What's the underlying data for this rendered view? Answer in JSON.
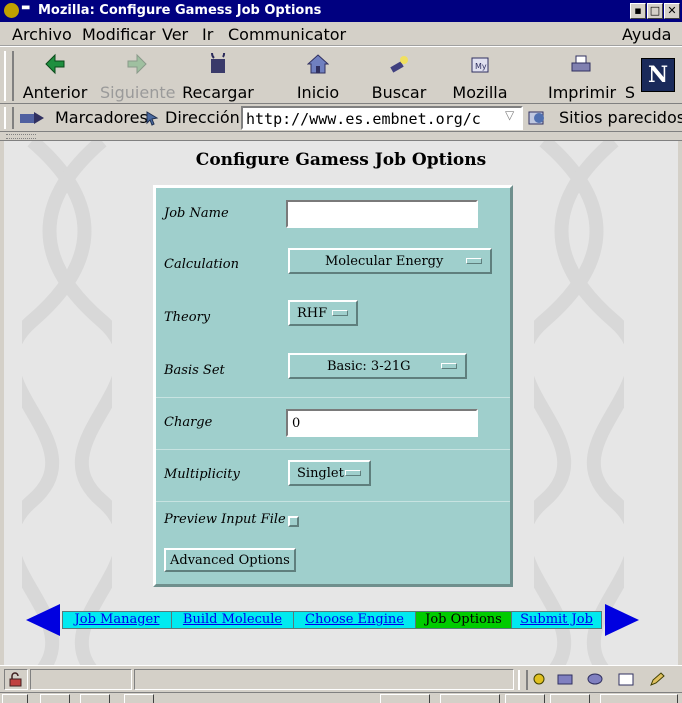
{
  "window": {
    "title": "Mozilla: Configure Gamess Job Options"
  },
  "menubar": {
    "items": [
      "Archivo",
      "Modificar",
      "Ver",
      "Ir",
      "Communicator"
    ],
    "help": "Ayuda"
  },
  "toolbar": {
    "back": "Anterior",
    "forward": "Siguiente",
    "reload": "Recargar",
    "home": "Inicio",
    "search": "Buscar",
    "mozilla": "Mozilla",
    "print": "Imprimir",
    "security": "S",
    "logo_letter": "N"
  },
  "locationbar": {
    "bookmarks": "Marcadores",
    "address_label": "Dirección:",
    "url": "http://www.es.embnet.org/c",
    "related": "Sitios parecidos"
  },
  "page": {
    "title": "Configure Gamess Job Options",
    "form": {
      "job_name_label": "Job Name",
      "job_name_value": "",
      "calculation_label": "Calculation",
      "calculation_value": "Molecular Energy",
      "theory_label": "Theory",
      "theory_value": "RHF",
      "basis_label": "Basis Set",
      "basis_value": "Basic: 3-21G",
      "charge_label": "Charge",
      "charge_value": "0",
      "multiplicity_label": "Multiplicity",
      "multiplicity_value": "Singlet",
      "preview_label": "Preview Input File",
      "preview_checked": false,
      "advanced_button": "Advanced Options"
    },
    "nav": {
      "items": [
        "Job Manager",
        "Build Molecule",
        "Choose Engine",
        "Job Options",
        "Submit Job"
      ],
      "active": "Job Options"
    }
  },
  "colors": {
    "panel": "#9fcfcc",
    "nav_strip": "#00eaf0",
    "nav_active": "#00cc00",
    "nav_arrow": "#0000e0",
    "titlebar": "#000080"
  }
}
